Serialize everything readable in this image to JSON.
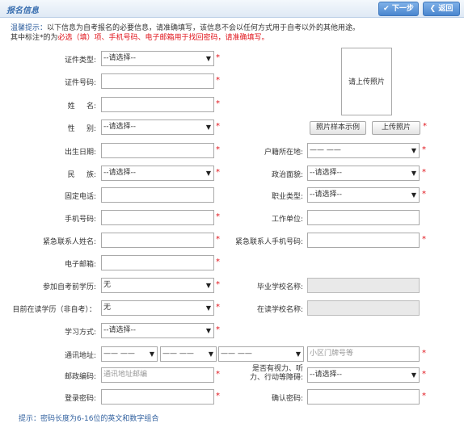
{
  "header": {
    "title": "报名信息",
    "next_label": "下一步",
    "back_label": "返回"
  },
  "notice": {
    "label": "温馨提示：",
    "line1": "以下信息为自考报名的必要信息，请准确填写，该信息不会以任何方式用于自考以外的其他用途。",
    "line2_prefix": "其中标注*的为",
    "line2_red": "必选（填）项、手机号码、电子邮箱用于找回密码，请准确填写。"
  },
  "star": "*",
  "select_placeholder": "--请选择--",
  "dash_placeholder": "—— ——",
  "none_value": "无",
  "fields": {
    "id_type": "证件类型:",
    "id_number": "证件号码:",
    "name": "姓     名:",
    "gender": "性     别:",
    "birth_date": "出生日期:",
    "ethnicity": "民     族:",
    "phone": "固定电话:",
    "mobile": "手机号码:",
    "emergency_name": "紧急联系人姓名:",
    "email": "电子邮箱:",
    "prior_education": "参加自考前学历:",
    "current_education": "目前在读学历（非自考）：",
    "study_mode": "学习方式:",
    "address": "通讯地址:",
    "postcode": "邮政编码:",
    "login_password": "登录密码:",
    "household": "户籍所在地:",
    "political": "政治面貌:",
    "occupation": "职业类型:",
    "workplace": "工作单位:",
    "emergency_mobile": "紧急联系人手机号码:",
    "grad_school": "毕业学校名称:",
    "current_school": "在读学校名称:",
    "disability_line1": "是否有视力、听",
    "disability_line2": "力、行动等障碍:",
    "confirm_password": "确认密码:"
  },
  "placeholders": {
    "street": "小区门牌号等",
    "postcode": "通讯地址邮编"
  },
  "photo": {
    "upload_text": "请上传照片",
    "sample_button": "照片样本示例",
    "upload_button": "上传照片"
  },
  "hint": "提示：密码长度为6-16位的英文和数字组合"
}
